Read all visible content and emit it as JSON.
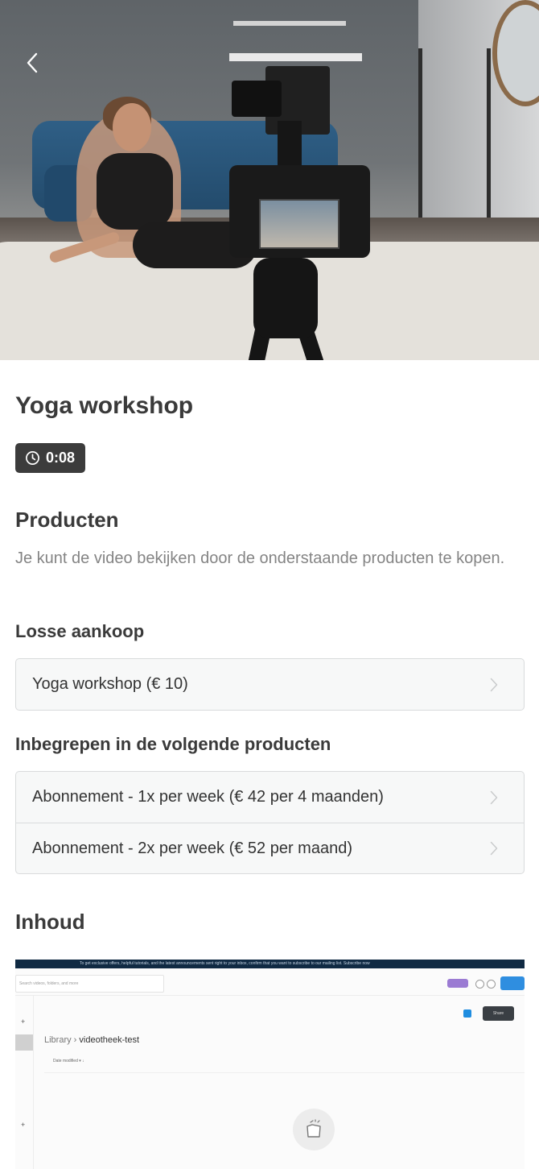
{
  "hero": {
    "alt": "Yoga workshop video"
  },
  "nav": {
    "back_icon": "chevron-left-icon"
  },
  "video": {
    "title": "Yoga workshop",
    "duration": "0:08",
    "duration_icon": "clock-icon"
  },
  "products": {
    "heading": "Producten",
    "description": "Je kunt de video bekijken door de onderstaande producten te kopen.",
    "single_purchase": {
      "heading": "Losse aankoop",
      "items": [
        {
          "label": "Yoga workshop (€ 10)"
        }
      ]
    },
    "included_in": {
      "heading": "Inbegrepen in de volgende producten",
      "items": [
        {
          "label": "Abonnement - 1x per week (€ 42 per 4 maanden)"
        },
        {
          "label": "Abonnement - 2x per week (€ 52 per maand)"
        }
      ]
    }
  },
  "content": {
    "heading": "Inhoud",
    "preview": {
      "banner": "To get exclusive offers, helpful tutorials, and the latest announcements sent right to your inbox, confirm that you want to subscribe to our mailing list.  Subscribe now",
      "search_placeholder": "Search videos, folders, and more",
      "share_label": "Share",
      "breadcrumb_root": "Library",
      "breadcrumb_sep": " › ",
      "breadcrumb_current": "videotheek-test",
      "sort_label": "Date modified ▾  ↓"
    }
  }
}
